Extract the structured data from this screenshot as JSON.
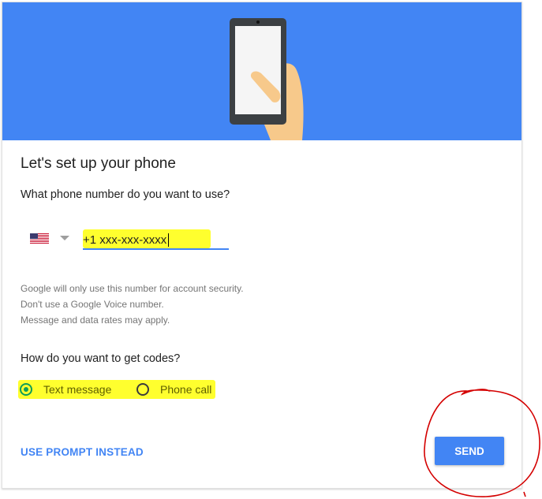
{
  "title": "Let's set up your phone",
  "phone_question": "What phone number do you want to use?",
  "country": {
    "flag_icon": "us-flag-icon",
    "dropdown_icon": "dropdown-arrow-icon"
  },
  "phone_input": {
    "value": "+1 xxx-xxx-xxxx"
  },
  "help_lines": [
    "Google will only use this number for account security.",
    "Don't use a Google Voice number.",
    "Message and data rates may apply."
  ],
  "codes_question": "How do you want to get codes?",
  "delivery_options": [
    {
      "label": "Text message",
      "selected": true
    },
    {
      "label": "Phone call",
      "selected": false
    }
  ],
  "actions": {
    "prompt_label": "USE PROMPT INSTEAD",
    "send_label": "SEND"
  },
  "colors": {
    "brand_blue": "#4285f4",
    "highlight_yellow": "#ffff2e",
    "annotation_red": "#d40000",
    "radio_green": "#0f9d58"
  }
}
